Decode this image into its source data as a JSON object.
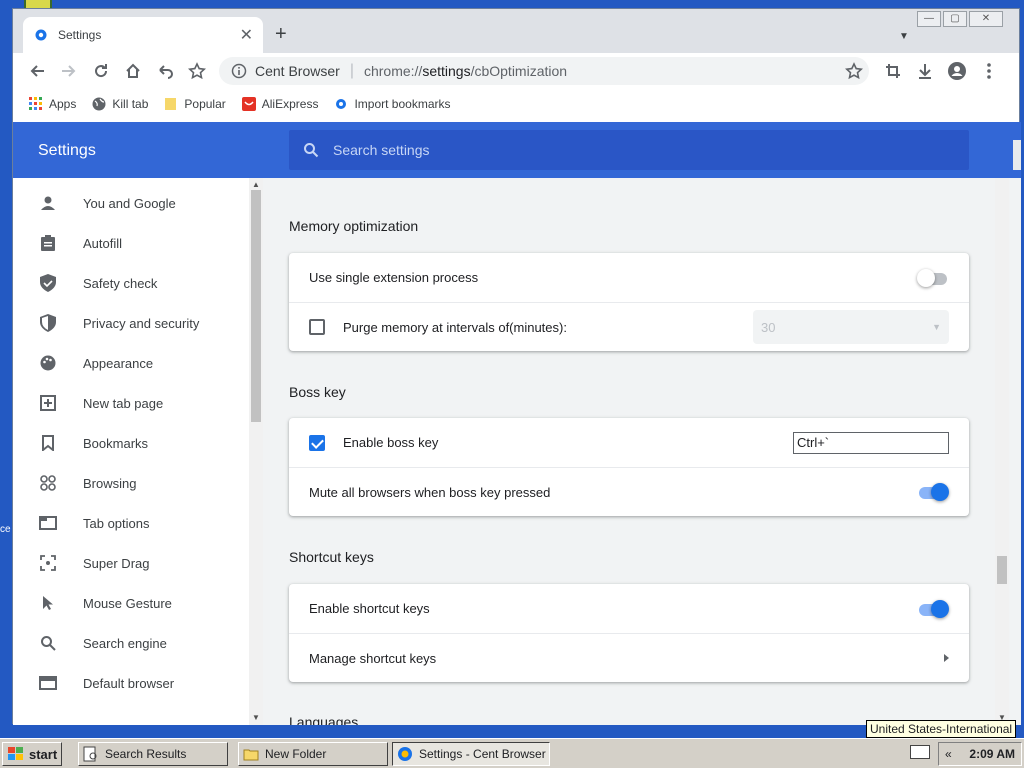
{
  "window": {
    "tab_title": "Settings",
    "tab_close": "✕",
    "new_tab": "+",
    "omnibox": {
      "site": "Cent Browser",
      "url_scheme": "chrome://",
      "url_host": "settings",
      "url_path": "/cbOptimization"
    }
  },
  "bookmarks": [
    {
      "label": "Apps",
      "icon": "apps-grid-icon"
    },
    {
      "label": "Kill tab",
      "icon": "globe-icon"
    },
    {
      "label": "Popular",
      "icon": "folder-icon"
    },
    {
      "label": "AliExpress",
      "icon": "aliexpress-icon"
    },
    {
      "label": "Import bookmarks",
      "icon": "gear-icon"
    }
  ],
  "settings": {
    "title": "Settings",
    "search_placeholder": "Search settings",
    "nav": [
      {
        "label": "You and Google",
        "icon": "person-icon"
      },
      {
        "label": "Autofill",
        "icon": "clipboard-icon"
      },
      {
        "label": "Safety check",
        "icon": "shield-check-icon"
      },
      {
        "label": "Privacy and security",
        "icon": "shield-icon"
      },
      {
        "label": "Appearance",
        "icon": "palette-icon"
      },
      {
        "label": "New tab page",
        "icon": "new-tab-icon"
      },
      {
        "label": "Bookmarks",
        "icon": "bookmark-icon"
      },
      {
        "label": "Browsing",
        "icon": "browsing-icon"
      },
      {
        "label": "Tab options",
        "icon": "tab-icon"
      },
      {
        "label": "Super Drag",
        "icon": "drag-icon"
      },
      {
        "label": "Mouse Gesture",
        "icon": "cursor-icon"
      },
      {
        "label": "Search engine",
        "icon": "search-icon"
      },
      {
        "label": "Default browser",
        "icon": "browser-icon"
      }
    ],
    "sections": {
      "memory": {
        "title": "Memory optimization",
        "single_process": {
          "label": "Use single extension process",
          "enabled": false
        },
        "purge": {
          "label": "Purge memory at intervals of(minutes):",
          "checked": false,
          "value": "30"
        }
      },
      "boss_key": {
        "title": "Boss key",
        "enable": {
          "label": "Enable boss key",
          "checked": true,
          "value": "Ctrl+`"
        },
        "mute": {
          "label": "Mute all browsers when boss key pressed",
          "enabled": true
        }
      },
      "shortcut_keys": {
        "title": "Shortcut keys",
        "enable": {
          "label": "Enable shortcut keys",
          "enabled": true
        },
        "manage": {
          "label": "Manage shortcut keys"
        }
      },
      "languages": {
        "title": "Languages"
      }
    }
  },
  "taskbar": {
    "start": "start",
    "items": [
      {
        "label": "Search Results",
        "active": false
      },
      {
        "label": "New Folder",
        "active": false
      },
      {
        "label": "Settings - Cent Browser",
        "active": true
      }
    ],
    "clock": "2:09 AM",
    "tray_chevron": "«",
    "tooltip": "United States-International"
  },
  "colors": {
    "accent": "#1a73e8",
    "header": "#3367d6",
    "taskbar": "#d4d0c8",
    "desktop": "#2359c2"
  }
}
